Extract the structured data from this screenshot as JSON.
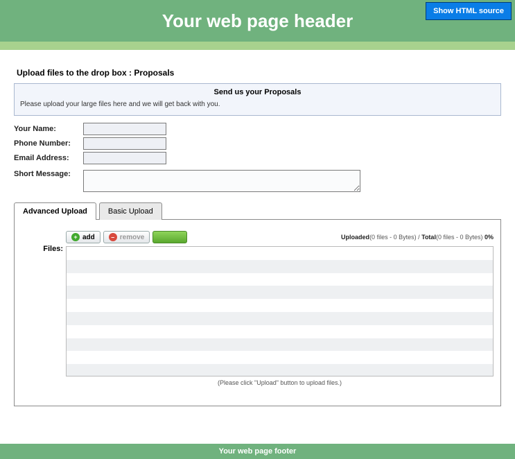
{
  "header": {
    "title": "Your web page header",
    "show_source": "Show HTML source"
  },
  "section": {
    "heading": "Upload files to the drop box :  Proposals",
    "box_title": "Send us your Proposals",
    "box_msg": "Please upload your large files here and we will get back with you."
  },
  "form": {
    "name_label": "Your Name:",
    "phone_label": "Phone Number:",
    "email_label": "Email Address:",
    "msg_label": "Short Message:",
    "name_val": "",
    "phone_val": "",
    "email_val": "",
    "msg_val": ""
  },
  "tabs": {
    "advanced": "Advanced Upload",
    "basic": "Basic Upload"
  },
  "files_label": "Files:",
  "toolbar": {
    "add": "add",
    "remove": "remove"
  },
  "status": {
    "uploaded_label": "Uploaded",
    "uploaded_detail": "(0 files - 0 Bytes)",
    "sep": " / ",
    "total_label": "Total",
    "total_detail": "(0 files - 0 Bytes)",
    "percent": " 0%"
  },
  "hint": "(Please click \"Upload\" button to upload files.)",
  "footer": "Your web page footer"
}
